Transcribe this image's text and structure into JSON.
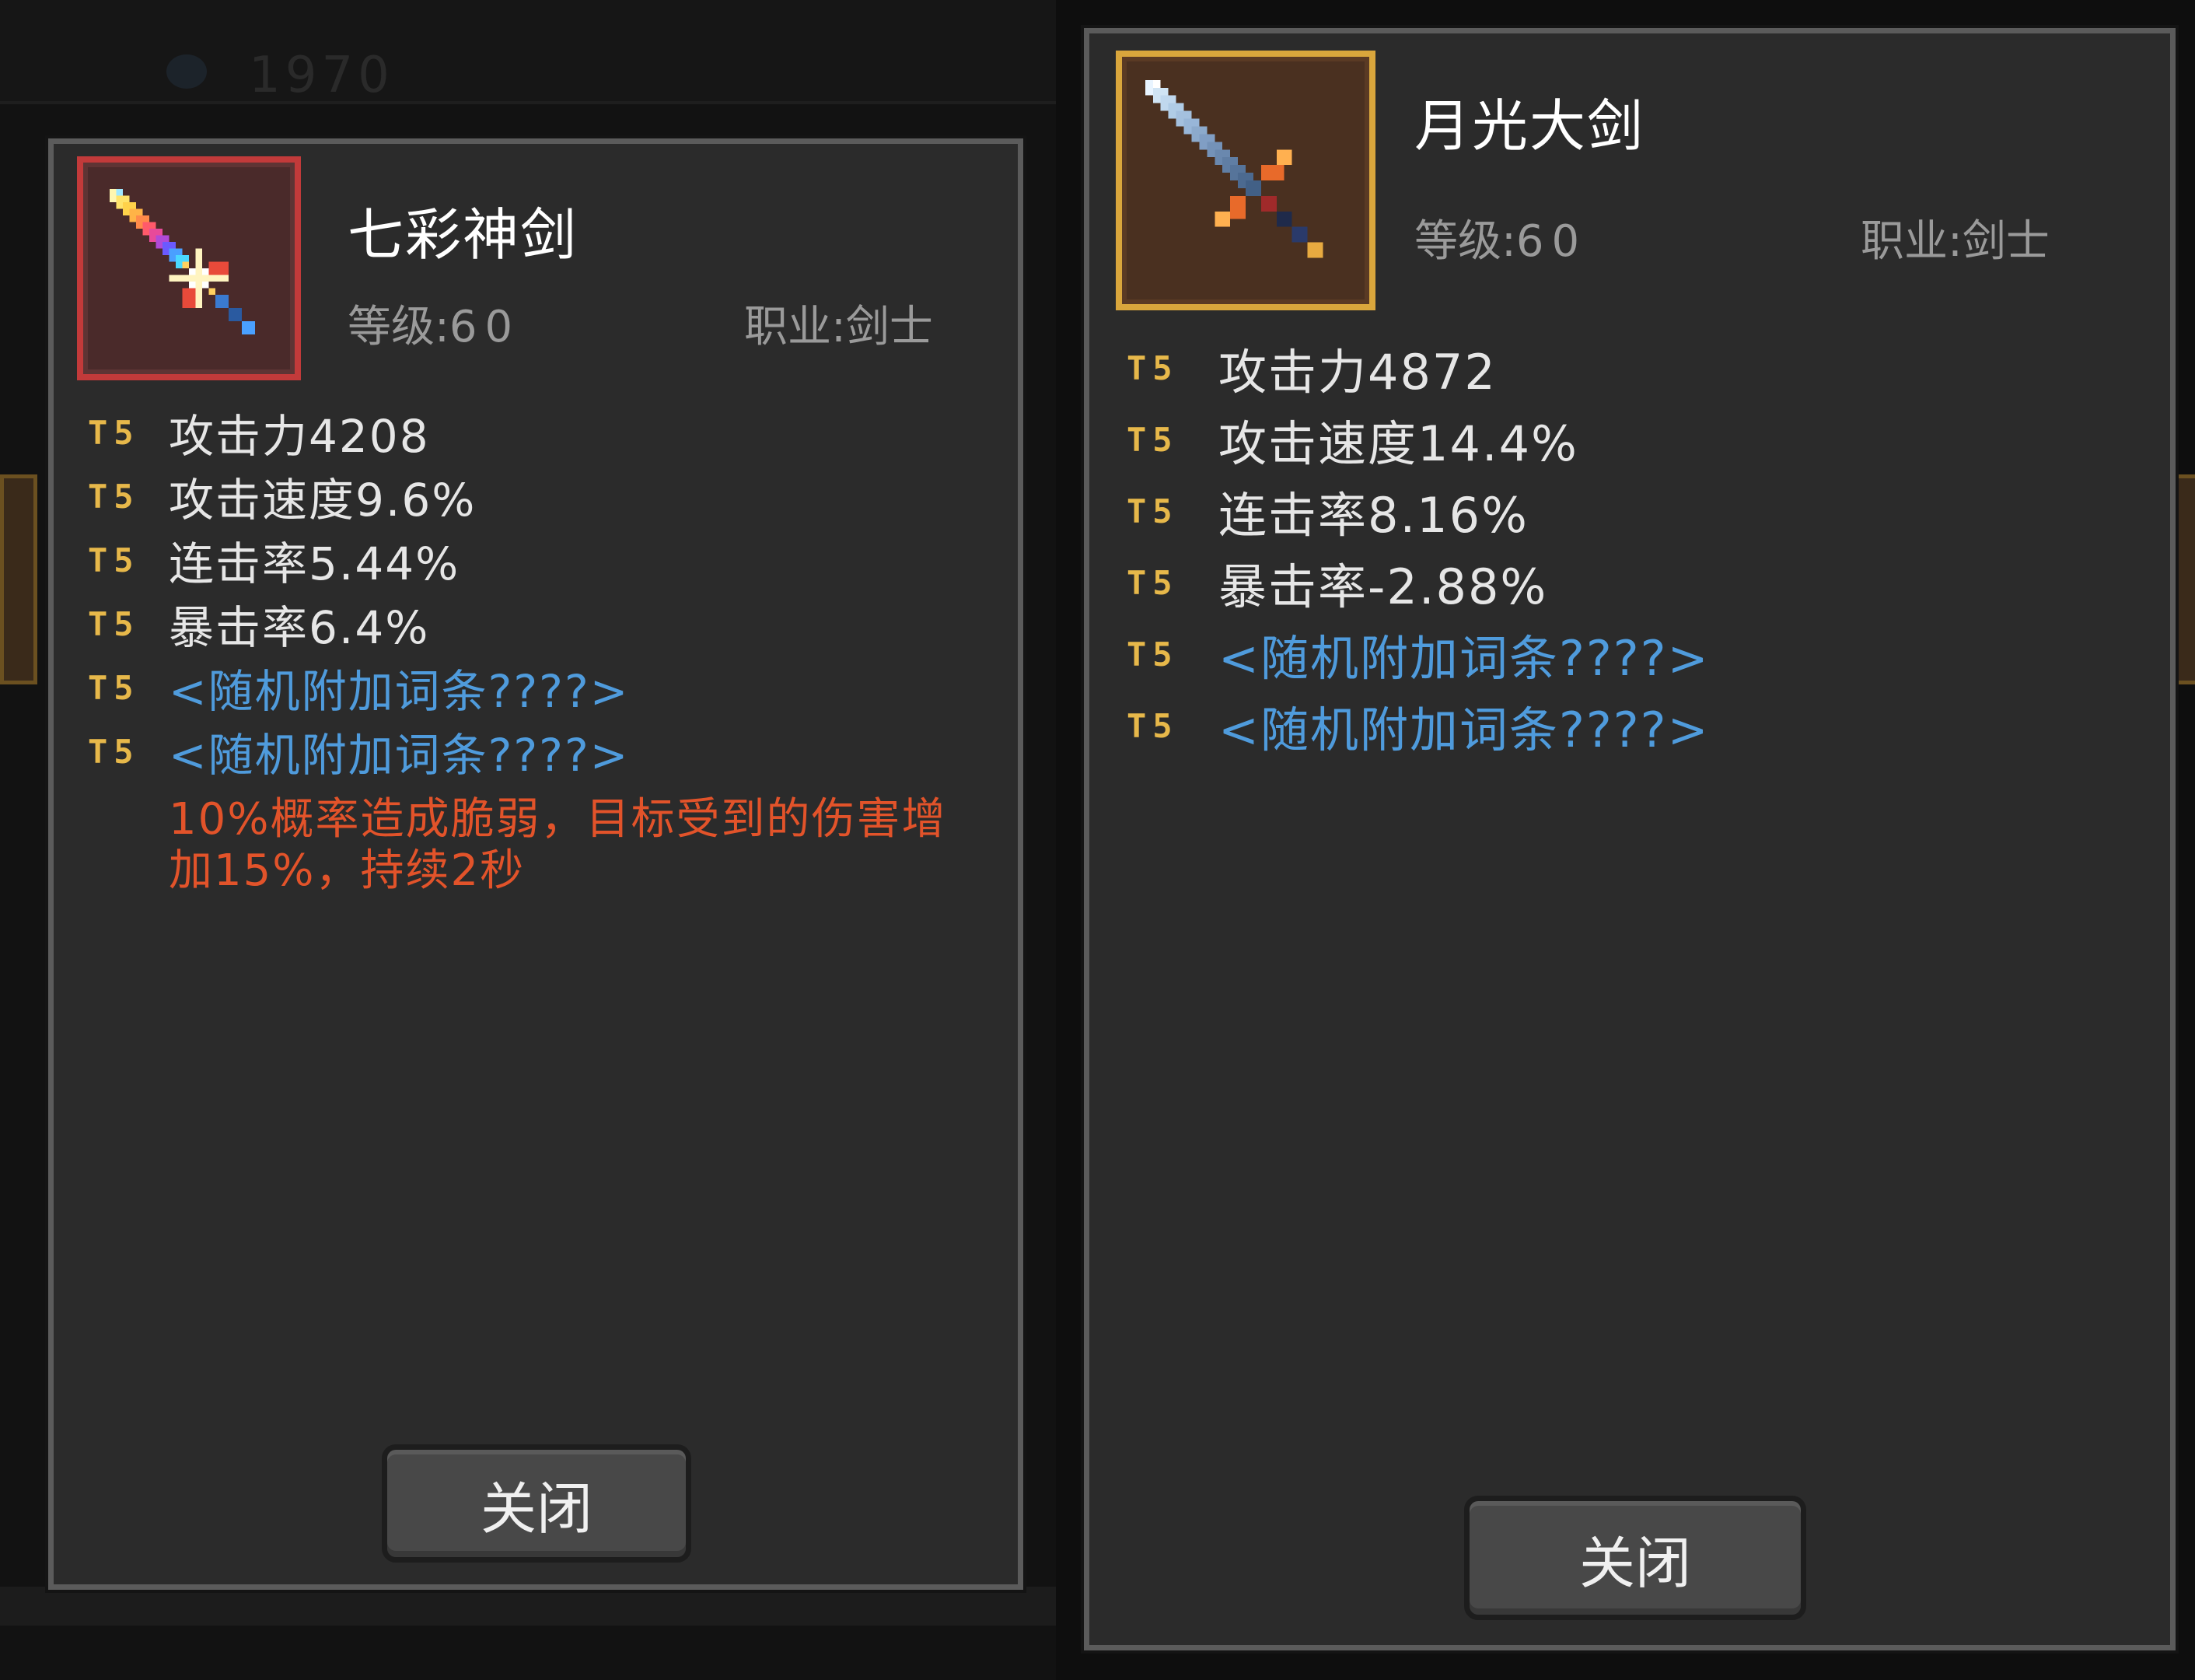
{
  "colors": {
    "tier": "#e7b84a",
    "stat_text": "#e6e6e6",
    "random_affix": "#4f9bdc",
    "special_effect": "#e2532a",
    "meta": "#9a9a9a",
    "panel_bg": "#2b2b2b",
    "panel_border": "#5b5b5b",
    "left_slot_border": "#c23a3a",
    "right_slot_border": "#d9a63c"
  },
  "background": {
    "currency_value": "1970"
  },
  "left_card": {
    "icon": "rainbow-sword-icon",
    "name": "七彩神剑",
    "level_label": "等级:",
    "level_value": "60",
    "class_label": "职业:剑士",
    "stats": [
      {
        "tier": "T5",
        "text": "攻击力4208"
      },
      {
        "tier": "T5",
        "text": "攻击速度9.6%"
      },
      {
        "tier": "T5",
        "text": "连击率5.44%"
      },
      {
        "tier": "T5",
        "text": "暴击率6.4%"
      },
      {
        "tier": "T5",
        "text": "<随机附加词条????>"
      },
      {
        "tier": "T5",
        "text": "<随机附加词条????>"
      }
    ],
    "special_line1": "10%概率造成脆弱，目标受到的伤害增",
    "special_line2": "加15%，持续2秒",
    "close_label": "关闭"
  },
  "right_card": {
    "icon": "moonlight-greatsword-icon",
    "name": "月光大剑",
    "level_label": "等级:",
    "level_value": "60",
    "class_label": "职业:剑士",
    "stats": [
      {
        "tier": "T5",
        "text": "攻击力4872"
      },
      {
        "tier": "T5",
        "text": "攻击速度14.4%"
      },
      {
        "tier": "T5",
        "text": "连击率8.16%"
      },
      {
        "tier": "T5",
        "text": "暴击率-2.88%"
      },
      {
        "tier": "T5",
        "text": "<随机附加词条????>"
      },
      {
        "tier": "T5",
        "text": "<随机附加词条????>"
      }
    ],
    "close_label": "关闭"
  }
}
